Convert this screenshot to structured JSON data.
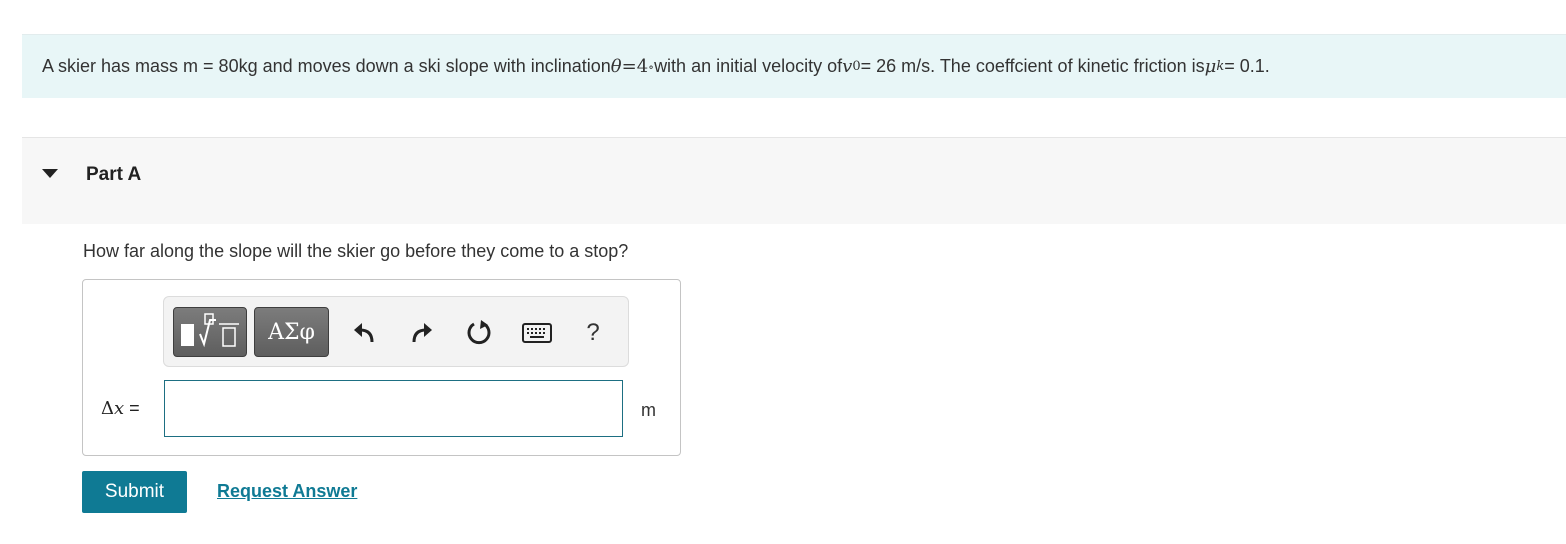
{
  "problem": {
    "t1": "A skier has mass m = 80kg and moves down a ski slope with inclination ",
    "theta": "θ",
    "eq": " = ",
    "four": "4",
    "deg": "∘",
    "t2": " with an initial velocity of ",
    "v": "v",
    "v_sub": "0",
    "t3": " = 26 m/s. The coeffcient of kinetic friction is ",
    "mu": "μ",
    "mu_sub": "k",
    "t4": " = 0.1."
  },
  "part": {
    "title": "Part A",
    "question": "How far along the slope will the skier go before they come to a stop?"
  },
  "toolbar": {
    "symbols_label": "ΑΣφ",
    "help_label": "?",
    "icons": [
      "templates-icon",
      "undo-icon",
      "redo-icon",
      "reset-icon",
      "keyboard-icon"
    ]
  },
  "answer": {
    "var_delta": "Δ",
    "var_x": "x",
    "var_eq": " =",
    "value": "",
    "unit": "m"
  },
  "actions": {
    "submit_label": "Submit",
    "request_label": "Request Answer"
  },
  "colors": {
    "problem_bg": "#e8f6f7",
    "accent": "#0f7a94",
    "input_border": "#1d6f82"
  }
}
